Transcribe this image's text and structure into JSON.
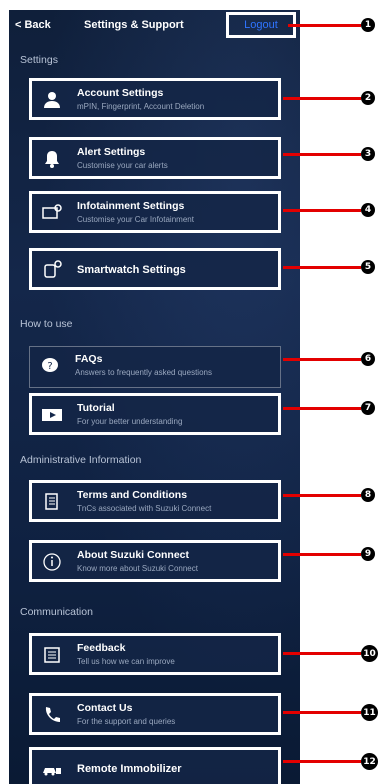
{
  "header": {
    "back_label": "< Back",
    "title": "Settings & Support",
    "logout_label": "Logout"
  },
  "sections": {
    "settings": "Settings",
    "how_to_use": "How to use",
    "admin": "Administrative Information",
    "communication": "Communication"
  },
  "cards": [
    {
      "title": "Account Settings",
      "subtitle": "mPIN, Fingerprint, Account Deletion",
      "icon": "account-icon"
    },
    {
      "title": "Alert Settings",
      "subtitle": "Customise your car alerts",
      "icon": "bell-icon"
    },
    {
      "title": "Infotainment Settings",
      "subtitle": "Customise your Car Infotainment",
      "icon": "infotainment-icon"
    },
    {
      "title": "Smartwatch Settings",
      "subtitle": "",
      "icon": "smartwatch-icon"
    },
    {
      "title": "FAQs",
      "subtitle": "Answers to frequently asked questions",
      "icon": "faq-icon"
    },
    {
      "title": "Tutorial",
      "subtitle": "For your better understanding",
      "icon": "play-icon"
    },
    {
      "title": "Terms and Conditions",
      "subtitle": "TnCs associated with Suzuki Connect",
      "icon": "document-icon"
    },
    {
      "title": "About Suzuki Connect",
      "subtitle": "Know more about Suzuki Connect",
      "icon": "info-icon"
    },
    {
      "title": "Feedback",
      "subtitle": "Tell us how we can improve",
      "icon": "feedback-icon"
    },
    {
      "title": "Contact Us",
      "subtitle": "For the support and queries",
      "icon": "phone-icon"
    },
    {
      "title": "Remote Immobilizer",
      "subtitle": "",
      "icon": "car-lock-icon"
    }
  ],
  "callouts": [
    "1",
    "2",
    "3",
    "4",
    "5",
    "6",
    "7",
    "8",
    "9",
    "10",
    "11",
    "12"
  ],
  "colors": {
    "callout_red": "#e30000",
    "logout_blue": "#2f74ff",
    "background": "#12264a"
  }
}
